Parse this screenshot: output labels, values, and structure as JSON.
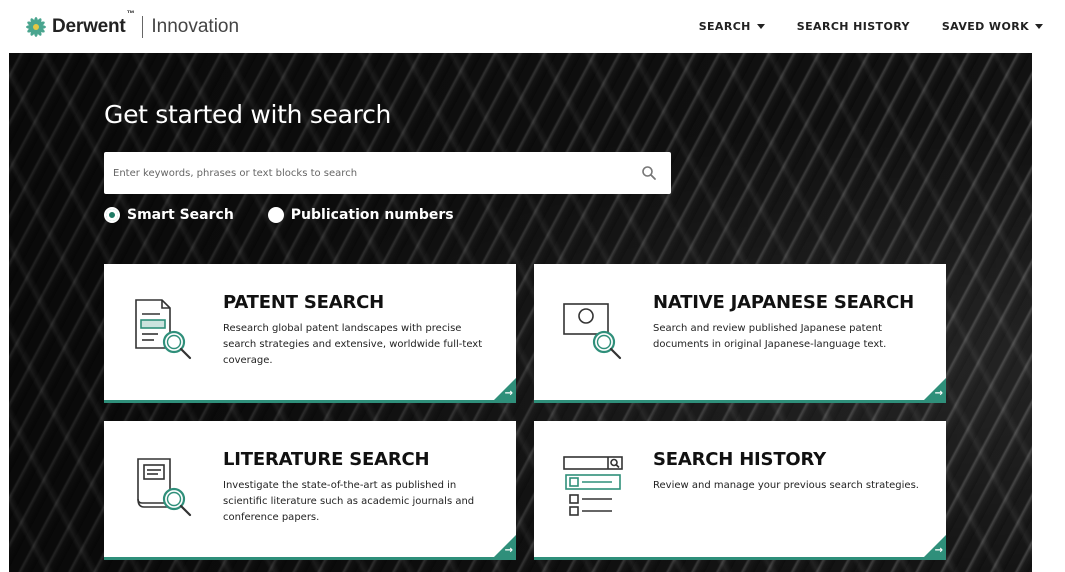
{
  "header": {
    "brand": "Derwent",
    "brand_tm": "™",
    "product": "Innovation",
    "nav": [
      {
        "label": "SEARCH",
        "has_caret": true
      },
      {
        "label": "SEARCH HISTORY",
        "has_caret": false
      },
      {
        "label": "SAVED WORK",
        "has_caret": true
      }
    ]
  },
  "hero": {
    "title": "Get started with search",
    "search": {
      "placeholder": "Enter keywords, phrases or text blocks to search",
      "value": "",
      "icon": "search-icon"
    },
    "search_mode": {
      "options": [
        {
          "label": "Smart Search",
          "selected": true
        },
        {
          "label": "Publication numbers",
          "selected": false
        }
      ]
    }
  },
  "cards": [
    {
      "title": "PATENT SEARCH",
      "description": "Research global patent landscapes with precise search strategies and extensive, worldwide full-text coverage.",
      "icon": "patent-document-magnifier-icon"
    },
    {
      "title": "NATIVE JAPANESE SEARCH",
      "description": "Search and review published Japanese patent documents in original Japanese-language text.",
      "icon": "japanese-flag-magnifier-icon"
    },
    {
      "title": "LITERATURE SEARCH",
      "description": "Investigate the state-of-the-art as published in scientific literature such as academic journals and conference papers.",
      "icon": "book-magnifier-icon"
    },
    {
      "title": "SEARCH HISTORY",
      "description": "Review and manage your previous search strategies.",
      "icon": "search-history-list-icon"
    }
  ],
  "colors": {
    "accent": "#2f8f7a",
    "header_text": "#222222",
    "card_title": "#111111"
  }
}
